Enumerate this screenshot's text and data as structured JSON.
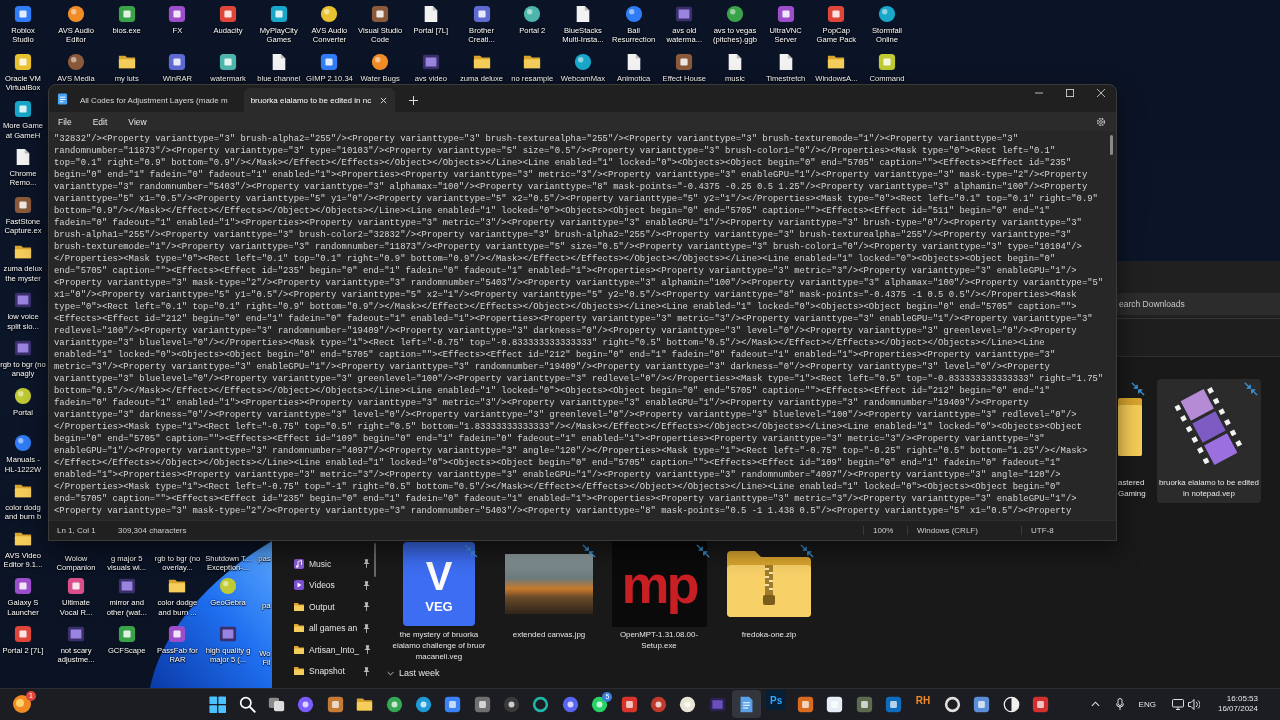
{
  "desktop": {
    "top_rows": [
      [
        {
          "label": "Roblox Studio",
          "kind": "app"
        },
        {
          "label": "AVS Audio Editor",
          "kind": "disc"
        },
        {
          "label": "bios.exe",
          "kind": "app"
        },
        {
          "label": "FX",
          "kind": "app"
        },
        {
          "label": "Audacity",
          "kind": "app"
        },
        {
          "label": "MyPlayCity Games",
          "kind": "app"
        },
        {
          "label": "AVS Audio Converter",
          "kind": "disc"
        },
        {
          "label": "Visual Studio Code",
          "kind": "app"
        },
        {
          "label": "Portal [7L]",
          "kind": "document"
        },
        {
          "label": "Brother Creati...",
          "kind": "app"
        },
        {
          "label": "Portal 2",
          "kind": "disc"
        },
        {
          "label": "BlueStacks Multi-Insta...",
          "kind": "document"
        },
        {
          "label": "Ball Resurrection",
          "kind": "disc"
        },
        {
          "label": "avs old waterma...",
          "kind": "video"
        },
        {
          "label": "avs to vegas (pitches).ggb",
          "kind": "disc"
        },
        {
          "label": "UltraVNC Server",
          "kind": "app"
        },
        {
          "label": "PopCap Game Pack",
          "kind": "app"
        },
        {
          "label": "Stormfall Online",
          "kind": "disc"
        }
      ],
      [
        {
          "label": "Oracle VM VirtualBox",
          "kind": "app"
        },
        {
          "label": "AVS Media",
          "kind": "disc"
        },
        {
          "label": "my luts",
          "kind": "folder"
        },
        {
          "label": "WinRAR",
          "kind": "app"
        },
        {
          "label": "watermark",
          "kind": "app"
        },
        {
          "label": "blue channel",
          "kind": "document"
        },
        {
          "label": "GIMP 2.10.34",
          "kind": "app"
        },
        {
          "label": "Water Bugs",
          "kind": "disc"
        },
        {
          "label": "avs video",
          "kind": "video"
        },
        {
          "label": "zuma deluxe",
          "kind": "folder"
        },
        {
          "label": "no resample",
          "kind": "folder"
        },
        {
          "label": "WebcamMax",
          "kind": "disc"
        },
        {
          "label": "Animotica",
          "kind": "document"
        },
        {
          "label": "Effect House",
          "kind": "app"
        },
        {
          "label": "music",
          "kind": "document"
        },
        {
          "label": "Timestretch",
          "kind": "document"
        },
        {
          "label": "WindowsA...",
          "kind": "folder"
        },
        {
          "label": "Command",
          "kind": "app"
        }
      ]
    ],
    "left_column": [
      {
        "label": "More Game at GameH",
        "kind": "app"
      },
      {
        "label": "Chrome Remo...",
        "kind": "document"
      },
      {
        "label": "FastStone Capture.ex",
        "kind": "app"
      },
      {
        "label": "zuma delux the myster",
        "kind": "folder"
      },
      {
        "label": "low voice split slo...",
        "kind": "video"
      },
      {
        "label": "rgb to bgr (no anagly",
        "kind": "video"
      },
      {
        "label": "Portal",
        "kind": "disc"
      },
      {
        "label": "Manuals - HL-1222W",
        "kind": "disc"
      },
      {
        "label": "color dodg and burn b",
        "kind": "folder"
      },
      {
        "label": "AVS Video Editor 9.1...",
        "kind": "folder"
      },
      {
        "label": "Galaxy S Launcher",
        "kind": "app"
      },
      {
        "label": "Portal 2 [7L]",
        "kind": "app"
      }
    ],
    "lower_group": [
      [
        {
          "label": "Wolow Companion"
        },
        {
          "label": "g major 5 visuals wi..."
        },
        {
          "label": "rgb to bgr (no overlay..."
        },
        {
          "label": "Shutdown T... Exception-..."
        },
        {
          "label": "pas"
        }
      ],
      [
        {
          "label": "Ultimate Vocal R...",
          "kind": "app"
        },
        {
          "label": "mirror and other (wat...",
          "kind": "video"
        },
        {
          "label": "color dodge and burn ...",
          "kind": "folder"
        },
        {
          "label": "GeoGebra",
          "kind": "disc"
        },
        {
          "label": "pa"
        }
      ],
      [
        {
          "label": "not scary adjustme...",
          "kind": "video"
        },
        {
          "label": "GCFScape",
          "kind": "app"
        },
        {
          "label": "PassFab for RAR",
          "kind": "app"
        },
        {
          "label": "high quality g major 5 (...",
          "kind": "video"
        },
        {
          "label": "Wo Fil"
        }
      ]
    ]
  },
  "explorer": {
    "search": {
      "placeholder": "earch Downloads"
    },
    "nav_items": [
      {
        "label": "Music",
        "kind": "music",
        "pinned": true
      },
      {
        "label": "Videos",
        "kind": "video",
        "pinned": true
      },
      {
        "label": "Output",
        "kind": "folder",
        "pinned": true
      },
      {
        "label": "all games an",
        "kind": "folder",
        "pinned": true
      },
      {
        "label": "Artisan_Into_",
        "kind": "folder",
        "pinned": true
      },
      {
        "label": "Snapshot",
        "kind": "folder",
        "pinned": true
      }
    ],
    "recent_files": [
      {
        "label": "astered Gaming",
        "kind": "folder",
        "selected": false
      },
      {
        "label": "bruorka eialamo to be edited in notepad.vep",
        "kind": "video",
        "selected": true
      }
    ],
    "files": [
      {
        "label": "the mystery of bruorka eialamo challenge of bruor macaneli.veg",
        "kind": "veg",
        "icon_letter": "V",
        "icon_caption": "VEG",
        "selected": false
      },
      {
        "label": "extended canvas.jpg",
        "kind": "photo",
        "selected": false
      },
      {
        "label": "OpenMPT-1.31.08.00-Setup.exe",
        "kind": "logo",
        "icon_letters": "mp",
        "selected": false
      },
      {
        "label": "fredoka-one.zip",
        "kind": "zip",
        "selected": false
      }
    ],
    "group_header": "Last week"
  },
  "notepad": {
    "tabs": [
      {
        "title": "All Codes for Adjustment Layers (made m",
        "selected": false
      },
      {
        "title": "bruorka eialamo to be edited in nc",
        "selected": true
      }
    ],
    "menu": [
      "File",
      "Edit",
      "View"
    ],
    "lines": [
      "\"32832\"/><Property varianttype=\"3\" brush-alpha2=\"255\"/><Property varianttype=\"3\" brush-texturealpha=\"255\"/><Property varianttype=\"3\" brush-texturemode=\"1\"/><Property varianttype=\"3\"",
      "randomnumber=\"11873\"/><Property varianttype=\"3\" type=\"10103\"/><Property varianttype=\"5\" size=\"0.5\"/><Property varianttype=\"3\" brush-color1=\"0\"/></Properties><Mask type=\"0\"><Rect left=\"0.1\"",
      "top=\"0.1\" right=\"0.9\" bottom=\"0.9\"/></Mask></Effect></Effects></Object></Objects></Line><Line enabled=\"1\" locked=\"0\"><Objects><Object begin=\"0\" end=\"5705\" caption=\"\"><Effects><Effect id=\"235\"",
      "begin=\"0\" end=\"1\" fadein=\"0\" fadeout=\"1\" enabled=\"1\"><Properties><Property varianttype=\"3\" metric=\"3\"/><Property varianttype=\"3\" enableGPU=\"1\"/><Property varianttype=\"3\" mask-type=\"2\"/><Property",
      "varianttype=\"3\" randomnumber=\"5403\"/><Property varianttype=\"3\" alphamax=\"100\"/><Property varianttype=\"8\" mask-points=\"-0.4375 -0.25 0.5 1.25\"/><Property varianttype=\"3\" alphamin=\"100\"/><Property",
      "varianttype=\"5\" x1=\"0.5\"/><Property varianttype=\"5\" y1=\"0\"/><Property varianttype=\"5\" x2=\"0.5\"/><Property varianttype=\"5\" y2=\"1\"/></Properties><Mask type=\"0\"><Rect left=\"0.1\" top=\"0.1\" right=\"0.9\"",
      "bottom=\"0.9\"/></Mask></Effect></Effects></Object></Objects></Line><Line enabled=\"1\" locked=\"0\"><Objects><Object begin=\"0\" end=\"5705\" caption=\"\"><Effects><Effect id=\"511\" begin=\"0\" end=\"1\"",
      "fadein=\"0\" fadeout=\"1\" enabled=\"1\"><Properties><Property varianttype=\"3\" metric=\"3\"/><Property varianttype=\"3\" enableGPU=\"1\"/><Property varianttype=\"3\" brush-type=\"0\"/><Property varianttype=\"3\"",
      "brush-alpha1=\"255\"/><Property varianttype=\"3\" brush-color2=\"32832\"/><Property varianttype=\"3\" brush-alpha2=\"255\"/><Property varianttype=\"3\" brush-texturealpha=\"255\"/><Property varianttype=\"3\"",
      "brush-texturemode=\"1\"/><Property varianttype=\"3\" randomnumber=\"11873\"/><Property varianttype=\"5\" size=\"0.5\"/><Property varianttype=\"3\" brush-color1=\"0\"/><Property varianttype=\"3\" type=\"10104\"/>",
      "</Properties><Mask type=\"0\"><Rect left=\"0.1\" top=\"0.1\" right=\"0.9\" bottom=\"0.9\"/></Mask></Effect></Effects></Object></Objects></Line><Line enabled=\"1\" locked=\"0\"><Objects><Object begin=\"0\"",
      "end=\"5705\" caption=\"\"><Effects><Effect id=\"235\" begin=\"0\" end=\"1\" fadein=\"0\" fadeout=\"1\" enabled=\"1\"><Properties><Property varianttype=\"3\" metric=\"3\"/><Property varianttype=\"3\" enableGPU=\"1\"/>",
      "<Property varianttype=\"3\" mask-type=\"2\"/><Property varianttype=\"3\" randomnumber=\"5403\"/><Property varianttype=\"3\" alphamin=\"100\"/><Property varianttype=\"3\" alphamax=\"100\"/><Property varianttype=\"5\"",
      "x1=\"0\"/><Property varianttype=\"5\" y1=\"0.5\"/><Property varianttype=\"5\" x2=\"1\"/><Property varianttype=\"5\" y2=\"0.5\"/><Property varianttype=\"8\" mask-points=\"-0.4375 -1 0.5 0.5\"/></Properties><Mask",
      "type=\"0\"><Rect left=\"0.1\" top=\"0.1\" right=\"0.9\" bottom=\"0.9\"/></Mask></Effect></Effects></Object></Objects></Line><Line enabled=\"1\" locked=\"0\"><Objects><Object begin=\"0\" end=\"5705\" caption=\"\">",
      "<Effects><Effect id=\"212\" begin=\"0\" end=\"1\" fadein=\"0\" fadeout=\"1\" enabled=\"1\"><Properties><Property varianttype=\"3\" metric=\"3\"/><Property varianttype=\"3\" enableGPU=\"1\"/><Property varianttype=\"3\"",
      "redlevel=\"100\"/><Property varianttype=\"3\" randomnumber=\"19409\"/><Property varianttype=\"3\" darkness=\"0\"/><Property varianttype=\"3\" level=\"0\"/><Property varianttype=\"3\" greenlevel=\"0\"/><Property",
      "varianttype=\"3\" bluelevel=\"0\"/></Properties><Mask type=\"1\"><Rect left=\"-0.75\" top=\"-0.833333333333333\" right=\"0.5\" bottom=\"0.5\"/></Mask></Effect></Effects></Object></Objects></Line><Line",
      "enabled=\"1\" locked=\"0\"><Objects><Object begin=\"0\" end=\"5705\" caption=\"\"><Effects><Effect id=\"212\" begin=\"0\" end=\"1\" fadein=\"0\" fadeout=\"1\" enabled=\"1\"><Properties><Property varianttype=\"3\"",
      "metric=\"3\"/><Property varianttype=\"3\" enableGPU=\"1\"/><Property varianttype=\"3\" randomnumber=\"19409\"/><Property varianttype=\"3\" darkness=\"0\"/><Property varianttype=\"3\" level=\"0\"/><Property",
      "varianttype=\"3\" bluelevel=\"0\"/><Property varianttype=\"3\" greenlevel=\"100\"/><Property varianttype=\"3\" redlevel=\"0\"/></Properties><Mask type=\"1\"><Rect left=\"0.5\" top=\"-0.833333333333333\" right=\"1.75\"",
      "bottom=\"0.5\"/></Mask></Effect></Effects></Object></Objects></Line><Line enabled=\"1\" locked=\"0\"><Objects><Object begin=\"0\" end=\"5705\" caption=\"\"><Effects><Effect id=\"212\" begin=\"0\" end=\"1\"",
      "fadein=\"0\" fadeout=\"1\" enabled=\"1\"><Properties><Property varianttype=\"3\" metric=\"3\"/><Property varianttype=\"3\" enableGPU=\"1\"/><Property varianttype=\"3\" randomnumber=\"19409\"/><Property",
      "varianttype=\"3\" darkness=\"0\"/><Property varianttype=\"3\" level=\"0\"/><Property varianttype=\"3\" greenlevel=\"0\"/><Property varianttype=\"3\" bluelevel=\"100\"/><Property varianttype=\"3\" redlevel=\"0\"/>",
      "</Properties><Mask type=\"1\"><Rect left=\"-0.75\" top=\"0.5\" right=\"0.5\" bottom=\"1.83333333333333\"/></Mask></Effect></Effects></Object></Objects></Line><Line enabled=\"1\" locked=\"0\"><Objects><Object",
      "begin=\"0\" end=\"5705\" caption=\"\"><Effects><Effect id=\"109\" begin=\"0\" end=\"1\" fadein=\"0\" fadeout=\"1\" enabled=\"1\"><Properties><Property varianttype=\"3\" metric=\"3\"/><Property varianttype=\"3\"",
      "enableGPU=\"1\"/><Property varianttype=\"3\" randomnumber=\"4097\"/><Property varianttype=\"3\" angle=\"120\"/></Properties><Mask type=\"1\"><Rect left=\"-0.75\" top=\"-0.25\" right=\"0.5\" bottom=\"1.25\"/></Mask>",
      "</Effect></Effects></Object></Objects></Line><Line enabled=\"1\" locked=\"0\"><Objects><Object begin=\"0\" end=\"5705\" caption=\"\"><Effects><Effect id=\"109\" begin=\"0\" end=\"1\" fadein=\"0\" fadeout=\"1\"",
      "enabled=\"1\"><Properties><Property varianttype=\"3\" metric=\"3\"/><Property varianttype=\"3\" enableGPU=\"1\"/><Property varianttype=\"3\" randomnumber=\"4097\"/><Property varianttype=\"3\" angle=\"120\"/>",
      "</Properties><Mask type=\"1\"><Rect left=\"-0.75\" top=\"-1\" right=\"0.5\" bottom=\"0.5\"/></Mask></Effect></Effects></Object></Objects></Line><Line enabled=\"1\" locked=\"0\"><Objects><Object begin=\"0\"",
      "end=\"5705\" caption=\"\"><Effects><Effect id=\"235\" begin=\"0\" end=\"1\" fadein=\"0\" fadeout=\"1\" enabled=\"1\"><Properties><Property varianttype=\"3\" metric=\"3\"/><Property varianttype=\"3\" enableGPU=\"1\"/>",
      "<Property varianttype=\"3\" mask-type=\"2\"/><Property varianttype=\"3\" randomnumber=\"5403\"/><Property varianttype=\"8\" mask-points=\"0.5 -1 1.438 0.5\"/><Property varianttype=\"5\" x1=\"0.5\"/><Property"
    ],
    "status_bar": {
      "position": "Ln 1, Col 1",
      "characters": "309,304 characters",
      "zoom": "100%",
      "line_ending": "Windows (CRLF)",
      "encoding": "UTF-8"
    }
  },
  "taskbar": {
    "widget": {
      "badge": "1"
    },
    "apps": [
      {
        "kind": "start",
        "selected": false
      },
      {
        "kind": "search",
        "selected": false
      },
      {
        "kind": "taskview",
        "selected": false
      },
      {
        "kind": "round",
        "selected": false
      },
      {
        "kind": "tile",
        "selected": false
      },
      {
        "kind": "folder",
        "selected": false
      },
      {
        "kind": "round",
        "selected": false
      },
      {
        "kind": "round",
        "selected": false
      },
      {
        "kind": "tile",
        "selected": false
      },
      {
        "kind": "tile",
        "selected": false
      },
      {
        "kind": "round",
        "selected": false
      },
      {
        "kind": "ring",
        "selected": false
      },
      {
        "kind": "round",
        "selected": false
      },
      {
        "kind": "round",
        "selected": false,
        "badge": "5"
      },
      {
        "kind": "tile",
        "selected": false
      },
      {
        "kind": "round",
        "selected": false
      },
      {
        "kind": "round",
        "selected": false
      },
      {
        "kind": "film",
        "selected": false
      },
      {
        "kind": "document",
        "selected": true
      },
      {
        "kind": "letters",
        "text": "Ps",
        "selected": false
      },
      {
        "kind": "tile",
        "selected": false
      },
      {
        "kind": "tile",
        "selected": false
      },
      {
        "kind": "tile",
        "selected": false
      },
      {
        "kind": "tile",
        "selected": false
      },
      {
        "kind": "letters",
        "text": "RH",
        "selected": false
      },
      {
        "kind": "ring",
        "selected": false
      },
      {
        "kind": "tile",
        "selected": false
      },
      {
        "kind": "half",
        "selected": false
      },
      {
        "kind": "tile",
        "selected": false
      }
    ],
    "tray": {
      "language": "ENG",
      "time": "16:05:53",
      "date": "16/07/2024"
    }
  }
}
